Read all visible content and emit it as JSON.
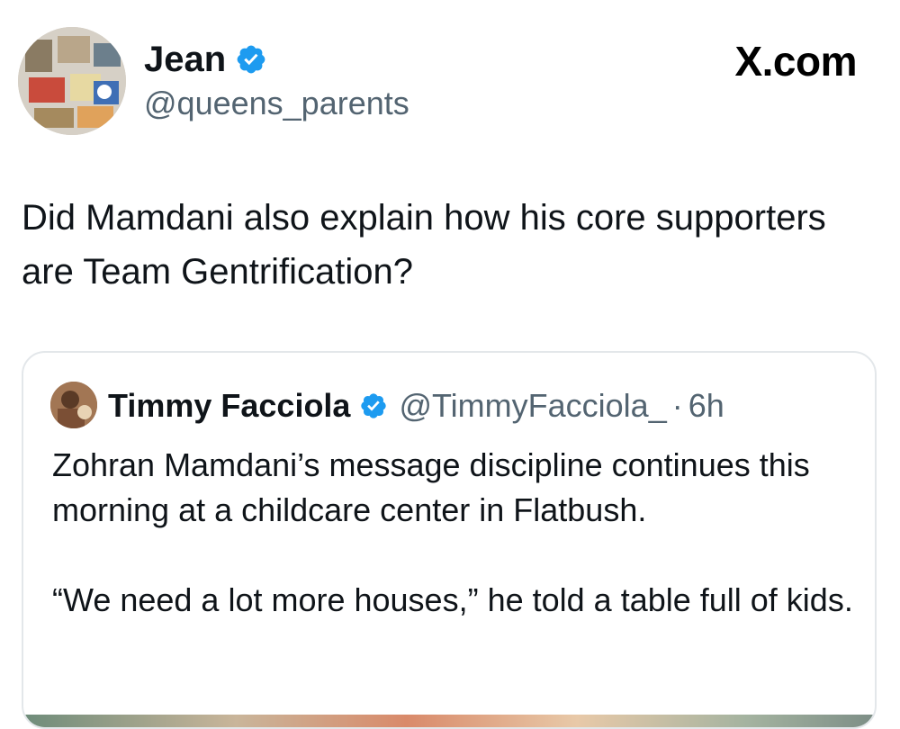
{
  "brand": {
    "label": "X.com"
  },
  "author": {
    "display_name": "Jean",
    "handle": "@queens_parents",
    "verified_icon": "verified-badge-icon",
    "verified_color": "#1d9bf0"
  },
  "tweet": {
    "text": "Did Mamdani also explain how his core supporters are Team Gentrification?"
  },
  "quoted_tweet": {
    "display_name": "Timmy Facciola",
    "handle": "@TimmyFacciola_",
    "separator": "·",
    "time": "6h",
    "paragraphs": [
      "Zohran Mamdani’s message discipline continues this morning at a childcare center in Flatbush.",
      "“We need a lot more houses,” he told a table full of kids."
    ]
  },
  "colors": {
    "text_primary": "#0f1419",
    "text_secondary": "#536471",
    "card_border": "#e3e7ea"
  }
}
